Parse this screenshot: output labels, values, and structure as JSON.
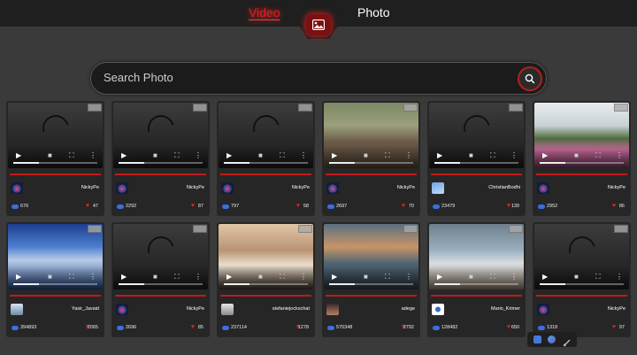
{
  "nav": {
    "video_label": "Video",
    "photo_label": "Photo",
    "active": "Video",
    "center_icon": "image-icon"
  },
  "search": {
    "placeholder": "Search Photo",
    "value": "",
    "icon": "search-icon"
  },
  "colors": {
    "accent": "#e01c1c",
    "background": "#3a3a3a",
    "card": "#262626",
    "views_icon": "#3b6ee0"
  },
  "cards": [
    {
      "user": "NickyPe",
      "views": "676",
      "likes": "47",
      "thumb": "none",
      "avatar": "eye"
    },
    {
      "user": "NickyPe",
      "views": "2292",
      "likes": "87",
      "thumb": "none",
      "avatar": "eye"
    },
    {
      "user": "NickyPe",
      "views": "797",
      "likes": "58",
      "thumb": "none",
      "avatar": "eye"
    },
    {
      "user": "NickyPe",
      "views": "2697",
      "likes": "70",
      "thumb": "monkeys",
      "avatar": "eye"
    },
    {
      "user": "ChristianBodhi",
      "views": "23479",
      "likes": "139",
      "thumb": "none",
      "avatar": "sky"
    },
    {
      "user": "NickyPe",
      "views": "2952",
      "likes": "86",
      "thumb": "flowers",
      "avatar": "eye"
    },
    {
      "user": "Yasir_Javaid",
      "views": "394893",
      "likes": "2065",
      "thumb": "mountain",
      "avatar": "person"
    },
    {
      "user": "NickyPe",
      "views": "2696",
      "likes": "85",
      "thumb": "none",
      "avatar": "eye"
    },
    {
      "user": "stefaniejockschat",
      "views": "237114",
      "likes": "1278",
      "thumb": "book",
      "avatar": "portrait"
    },
    {
      "user": "adege",
      "views": "570348",
      "likes": "2792",
      "thumb": "sunset",
      "avatar": "dark"
    },
    {
      "user": "Mario_Krimer",
      "views": "128482",
      "likes": "650",
      "thumb": "beach",
      "avatar": "logo"
    },
    {
      "user": "NickyPe",
      "views": "1318",
      "likes": "97",
      "thumb": "none",
      "avatar": "eye"
    }
  ],
  "card_icons": {
    "play": "play-icon",
    "volume": "volume-icon",
    "fullscreen": "fullscreen-icon",
    "menu": "more-icon",
    "pip": "picture-in-picture-icon",
    "views": "eye-icon",
    "likes": "heart-icon"
  },
  "floating_tools": [
    "window-icon",
    "layers-icon",
    "brush-icon"
  ]
}
